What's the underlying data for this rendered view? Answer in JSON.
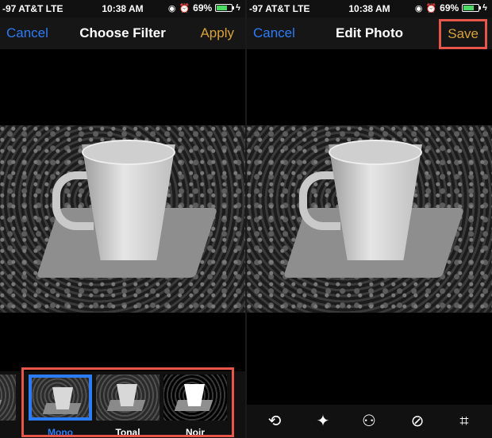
{
  "left_screen": {
    "status": {
      "carrier": "-97 AT&T  LTE",
      "time": "10:38 AM",
      "battery": "69%"
    },
    "nav": {
      "cancel": "Cancel",
      "title": "Choose Filter",
      "apply": "Apply"
    },
    "filters": [
      {
        "label": "e",
        "selected": false
      },
      {
        "label": "Mono",
        "selected": true
      },
      {
        "label": "Tonal",
        "selected": false
      },
      {
        "label": "Noir",
        "selected": false
      }
    ]
  },
  "right_screen": {
    "status": {
      "carrier": "-97 AT&T  LTE",
      "time": "10:38 AM",
      "battery": "69%"
    },
    "nav": {
      "cancel": "Cancel",
      "title": "Edit Photo",
      "save": "Save"
    },
    "toolbar": [
      {
        "icon": "rotate-icon"
      },
      {
        "icon": "magic-wand-icon"
      },
      {
        "icon": "filters-icon"
      },
      {
        "icon": "red-eye-icon"
      },
      {
        "icon": "crop-icon"
      }
    ]
  },
  "colors": {
    "accent_blue": "#2c7cf6",
    "accent_gold": "#d9a13a",
    "highlight_red": "#e8554a",
    "battery_green": "#4cd964"
  }
}
